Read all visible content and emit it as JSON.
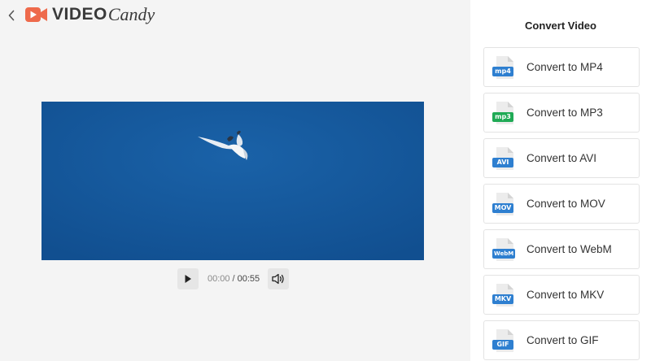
{
  "brand": {
    "video_text": "VIDEO",
    "candy_text": "Candy",
    "logo_color": "#ee6a4b"
  },
  "player": {
    "current_time": "00:00",
    "separator": "/",
    "duration": "00:55",
    "progress": 0,
    "video_bg": "#15599c"
  },
  "sidebar": {
    "title": "Convert Video",
    "items": [
      {
        "label": "Convert to MP4",
        "format": "mp4",
        "tag_color": "#2e7fd0"
      },
      {
        "label": "Convert to MP3",
        "format": "mp3",
        "tag_color": "#1faa55"
      },
      {
        "label": "Convert to AVI",
        "format": "AVI",
        "tag_color": "#2e7fd0"
      },
      {
        "label": "Convert to MOV",
        "format": "MOV",
        "tag_color": "#2e7fd0"
      },
      {
        "label": "Convert to WebM",
        "format": "WebM",
        "tag_color": "#2e7fd0"
      },
      {
        "label": "Convert to MKV",
        "format": "MKV",
        "tag_color": "#2e7fd0"
      },
      {
        "label": "Convert to GIF",
        "format": "GIF",
        "tag_color": "#2e7fd0"
      }
    ]
  }
}
